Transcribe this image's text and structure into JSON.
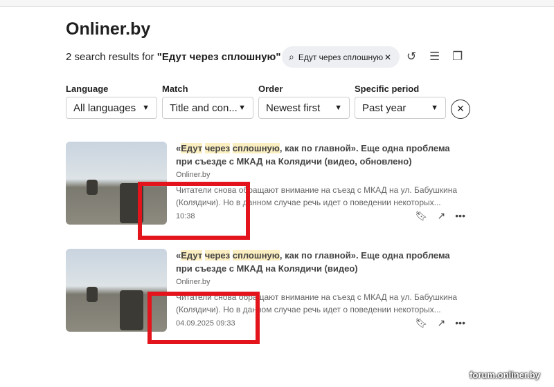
{
  "site_title": "Onliner.by",
  "summary": {
    "prefix": "2 search results for ",
    "query": "\"Едут через сплошную\""
  },
  "search": {
    "value": "Едут через сплошную"
  },
  "filters": [
    {
      "label": "Language",
      "value": "All languages"
    },
    {
      "label": "Match",
      "value": "Title and con..."
    },
    {
      "label": "Order",
      "value": "Newest first"
    },
    {
      "label": "Specific period",
      "value": "Past year"
    }
  ],
  "results": [
    {
      "hl": [
        "Едут",
        "через",
        "сплошную"
      ],
      "open": "«",
      "title_rest": ", как по главной». Еще одна проблема при съезде с МКАД на Колядичи (видео, обновлено)",
      "source": "Onliner.by",
      "snippet": "Читатели снова обращают внимание на съезд с МКАД на ул. Бабушкина (Колядичи). Но в данном случае речь идет о поведении некоторых...",
      "time": "10:38"
    },
    {
      "hl": [
        "Едут",
        "через",
        "сплошную"
      ],
      "open": "«",
      "title_rest": ", как по главной». Еще одна проблема при съезде с МКАД на Колядичи (видео)",
      "source": "Onliner.by",
      "snippet": "Читатели снова обращают внимание на съезд с МКАД на ул. Бабушкина (Колядичи). Но в данном случае речь идет о поведении некоторых...",
      "time": "04.09.2025 09:33"
    }
  ],
  "watermark": "forum.onliner.by"
}
